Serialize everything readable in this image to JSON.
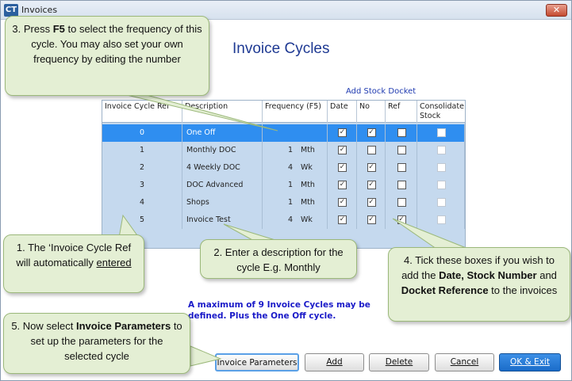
{
  "window": {
    "title": "Invoices",
    "app_icon": "CT"
  },
  "heading": "Invoice Cycles",
  "add_stock_label": "Add Stock Docket",
  "columns": {
    "ref": "Invoice Cycle Ref",
    "description": "Description",
    "frequency": "Frequency (F5)",
    "date": "Date",
    "no": "No",
    "refcol": "Ref",
    "consolidate_1": "Consolidate",
    "consolidate_2": "Stock"
  },
  "rows": [
    {
      "ref": "0",
      "description": "One Off",
      "freq_num": "",
      "freq_unit": "",
      "date": true,
      "no": true,
      "refc": false,
      "consolidate": false
    },
    {
      "ref": "1",
      "description": "Monthly DOC",
      "freq_num": "1",
      "freq_unit": "Mth",
      "date": true,
      "no": false,
      "refc": false,
      "consolidate": false
    },
    {
      "ref": "2",
      "description": "4 Weekly DOC",
      "freq_num": "4",
      "freq_unit": "Wk",
      "date": true,
      "no": true,
      "refc": false,
      "consolidate": false
    },
    {
      "ref": "3",
      "description": "DOC Advanced",
      "freq_num": "1",
      "freq_unit": "Mth",
      "date": true,
      "no": true,
      "refc": false,
      "consolidate": false
    },
    {
      "ref": "4",
      "description": "Shops",
      "freq_num": "1",
      "freq_unit": "Mth",
      "date": true,
      "no": true,
      "refc": false,
      "consolidate": false
    },
    {
      "ref": "5",
      "description": "Invoice Test",
      "freq_num": "4",
      "freq_unit": "Wk",
      "date": true,
      "no": true,
      "refc": true,
      "consolidate": false
    }
  ],
  "footer_note": "A maximum of 9 Invoice Cycles may be defined. Plus the One Off cycle.",
  "buttons": {
    "invoice_parameters": "Invoice Parameters",
    "add": "Add",
    "delete": "Delete",
    "cancel": "Cancel",
    "ok_exit": "OK & Exit"
  },
  "callouts": {
    "c3": {
      "a": "3.   Press ",
      "b": "F5",
      "c": " to select the frequency of this cycle.  You may also set your own frequency by editing the number"
    },
    "c1": {
      "a": "1.   The ‘Invoice Cycle Ref will automatically ",
      "b": "entered"
    },
    "c2": {
      "a": "2.    Enter a description for the cycle E.g. Monthly"
    },
    "c4": {
      "a": "4.    Tick these boxes if you wish to add the ",
      "b": "Date, Stock Number",
      "c": " and ",
      "d": "Docket Reference",
      "e": " to the invoices"
    },
    "c5": {
      "a": "5.    Now select ",
      "b": "Invoice Parameters",
      "c": " to set up the parameters for the selected cycle"
    }
  },
  "colors": {
    "accent": "#2f8ef0",
    "heading": "#1f3a93",
    "callout_bg": "#e4efd4"
  }
}
